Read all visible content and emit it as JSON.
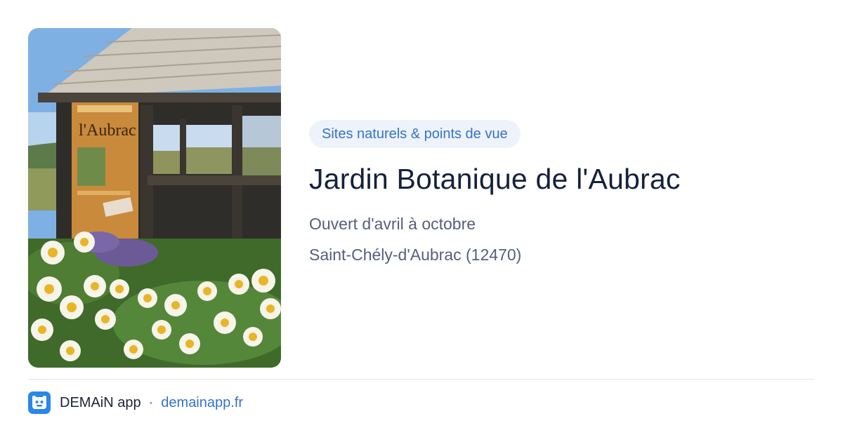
{
  "card": {
    "image": {
      "subject": "photo-garden-pavilion-daisies"
    },
    "category_badge": "Sites naturels & points de vue",
    "title": "Jardin Botanique de l'Aubrac",
    "opening_hours": "Ouvert d'avril à octobre",
    "address": "Saint-Chély-d'Aubrac (12470)",
    "poster_text": "l'Aubrac"
  },
  "footer": {
    "app_icon": "demain-app-icon",
    "app_name": "DEMAiN app",
    "separator": "·",
    "site_link": "demainapp.fr"
  },
  "colors": {
    "accent": "#3572c9",
    "badge_bg": "#eef3fb",
    "title": "#16213a",
    "meta": "#55607a",
    "app_icon_bg": "#2a86e8"
  }
}
